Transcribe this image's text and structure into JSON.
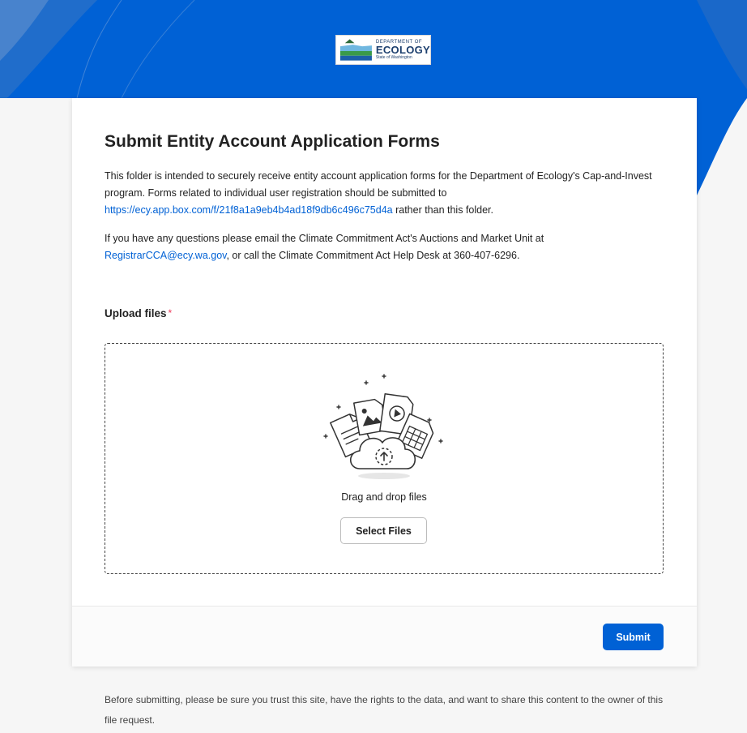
{
  "brand": {
    "header_color": "#0061d5",
    "accent_color": "#0061d5",
    "logo": {
      "department": "DEPARTMENT OF",
      "name": "ECOLOGY",
      "state": "State of Washington"
    }
  },
  "form": {
    "title": "Submit Entity Account Application Forms",
    "description": {
      "part1": "This folder is intended to securely receive entity account application forms for the Department of Ecology's Cap-and-Invest program. Forms related to individual user registration should be submitted to ",
      "link": "https://ecy.app.box.com/f/21f8a1a9eb4b4ad18f9db6c496c75d4a",
      "part2": " rather than this folder."
    },
    "contact": {
      "part1": "If you have any questions please email the Climate Commitment Act's Auctions and Market Unit at ",
      "email": "RegistrarCCA@ecy.wa.gov",
      "part2": ", or call the Climate Commitment Act Help Desk at 360-407-6296."
    },
    "upload": {
      "label": "Upload files",
      "required_marker": "*",
      "drop_text": "Drag and drop files",
      "select_button": "Select Files",
      "illustration_icon": "cloud-upload-files-icon"
    },
    "submit_label": "Submit"
  },
  "disclaimer": "Before submitting, please be sure you trust this site, have the rights to the data, and want to share this content to the owner of this file request."
}
